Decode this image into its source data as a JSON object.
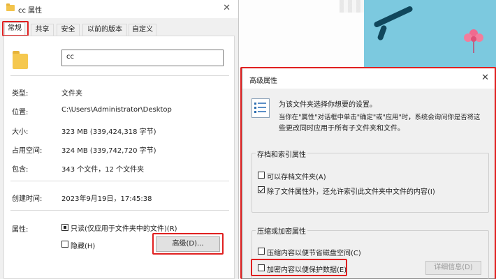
{
  "properties_dialog": {
    "title": "cc 属性",
    "close_glyph": "✕",
    "tabs": [
      {
        "label": "常规",
        "active": true
      },
      {
        "label": "共享",
        "active": false
      },
      {
        "label": "安全",
        "active": false
      },
      {
        "label": "以前的版本",
        "active": false
      },
      {
        "label": "自定义",
        "active": false
      }
    ],
    "folder_name": "cc",
    "rows": [
      {
        "label": "类型:",
        "value": "文件夹"
      },
      {
        "label": "位置:",
        "value": "C:\\Users\\Administrator\\Desktop"
      },
      {
        "label": "大小:",
        "value": "323 MB (339,424,318 字节)"
      },
      {
        "label": "占用空间:",
        "value": "324 MB (339,742,720 字节)"
      },
      {
        "label": "包含:",
        "value": "343 个文件，12 个文件夹"
      },
      {
        "label": "创建时间:",
        "value": "2023年9月19日，17:45:38"
      }
    ],
    "attributes_label": "属性:",
    "readonly_label": "只读(仅应用于文件夹中的文件)(R)",
    "hidden_label": "隐藏(H)",
    "advanced_button": "高级(D)..."
  },
  "advanced_dialog": {
    "title": "高级属性",
    "close_glyph": "✕",
    "intro_line1": "为该文件夹选择你想要的设置。",
    "intro_line2": "当你在\"属性\"对话框中单击\"确定\"或\"应用\"时，系统会询问你是否将这",
    "intro_line3": "些更改同时应用于所有子文件夹和文件。",
    "archive_group_label": "存档和索引属性",
    "archive_checkbox_label": "可以存档文件夹(A)",
    "archive_checked": false,
    "index_checkbox_label": "除了文件属性外，还允许索引此文件夹中文件的内容(I)",
    "index_checked": true,
    "compress_group_label": "压缩或加密属性",
    "compress_checkbox_label": "压缩内容以便节省磁盘空间(C)",
    "compress_checked": false,
    "encrypt_checkbox_label": "加密内容以便保护数据(E)",
    "encrypt_checked": false,
    "details_button": "详细信息(D)"
  },
  "colors": {
    "highlight": "#e02020",
    "folder": "#f5c84f",
    "illustration_bg": "#7cc9df"
  }
}
